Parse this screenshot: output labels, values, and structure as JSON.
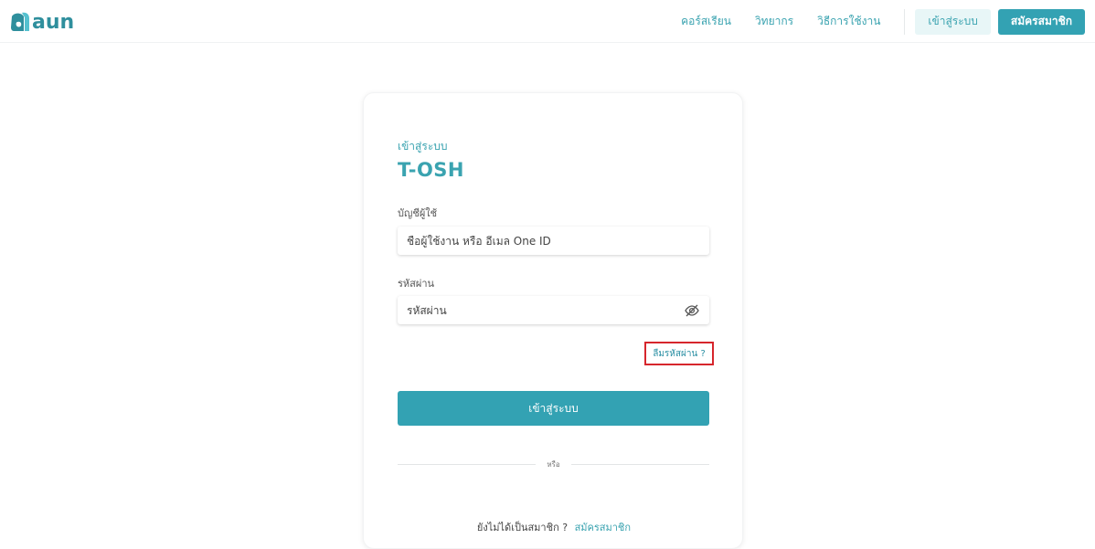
{
  "header": {
    "logo_text": "aun",
    "nav": {
      "courses": "คอร์สเรียน",
      "lecturers": "วิทยากร",
      "how_to": "วิธีการใช้งาน"
    },
    "login_button": "เข้าสู่ระบบ",
    "register_button": "สมัครสมาชิก"
  },
  "card": {
    "subtitle": "เข้าสู่ระบบ",
    "title": "T-OSH",
    "username_label": "บัญชีผู้ใช้",
    "username_placeholder": "ชื่อผู้ใช้งาน หรือ อีเมล One ID",
    "password_label": "รหัสผ่าน",
    "password_placeholder": "รหัสผ่าน",
    "password_icon": "eye-off-icon",
    "forgot_password": "ลืมรหัสผ่าน ?",
    "submit_button": "เข้าสู่ระบบ",
    "or_text": "หรือ",
    "not_member_text": "ยังไม่ได้เป็นสมาชิก ?",
    "register_link": "สมัครสมาชิก"
  },
  "colors": {
    "accent": "#33a2b3",
    "accent_text": "#3aa3b0",
    "highlight_border": "#d6262c"
  }
}
